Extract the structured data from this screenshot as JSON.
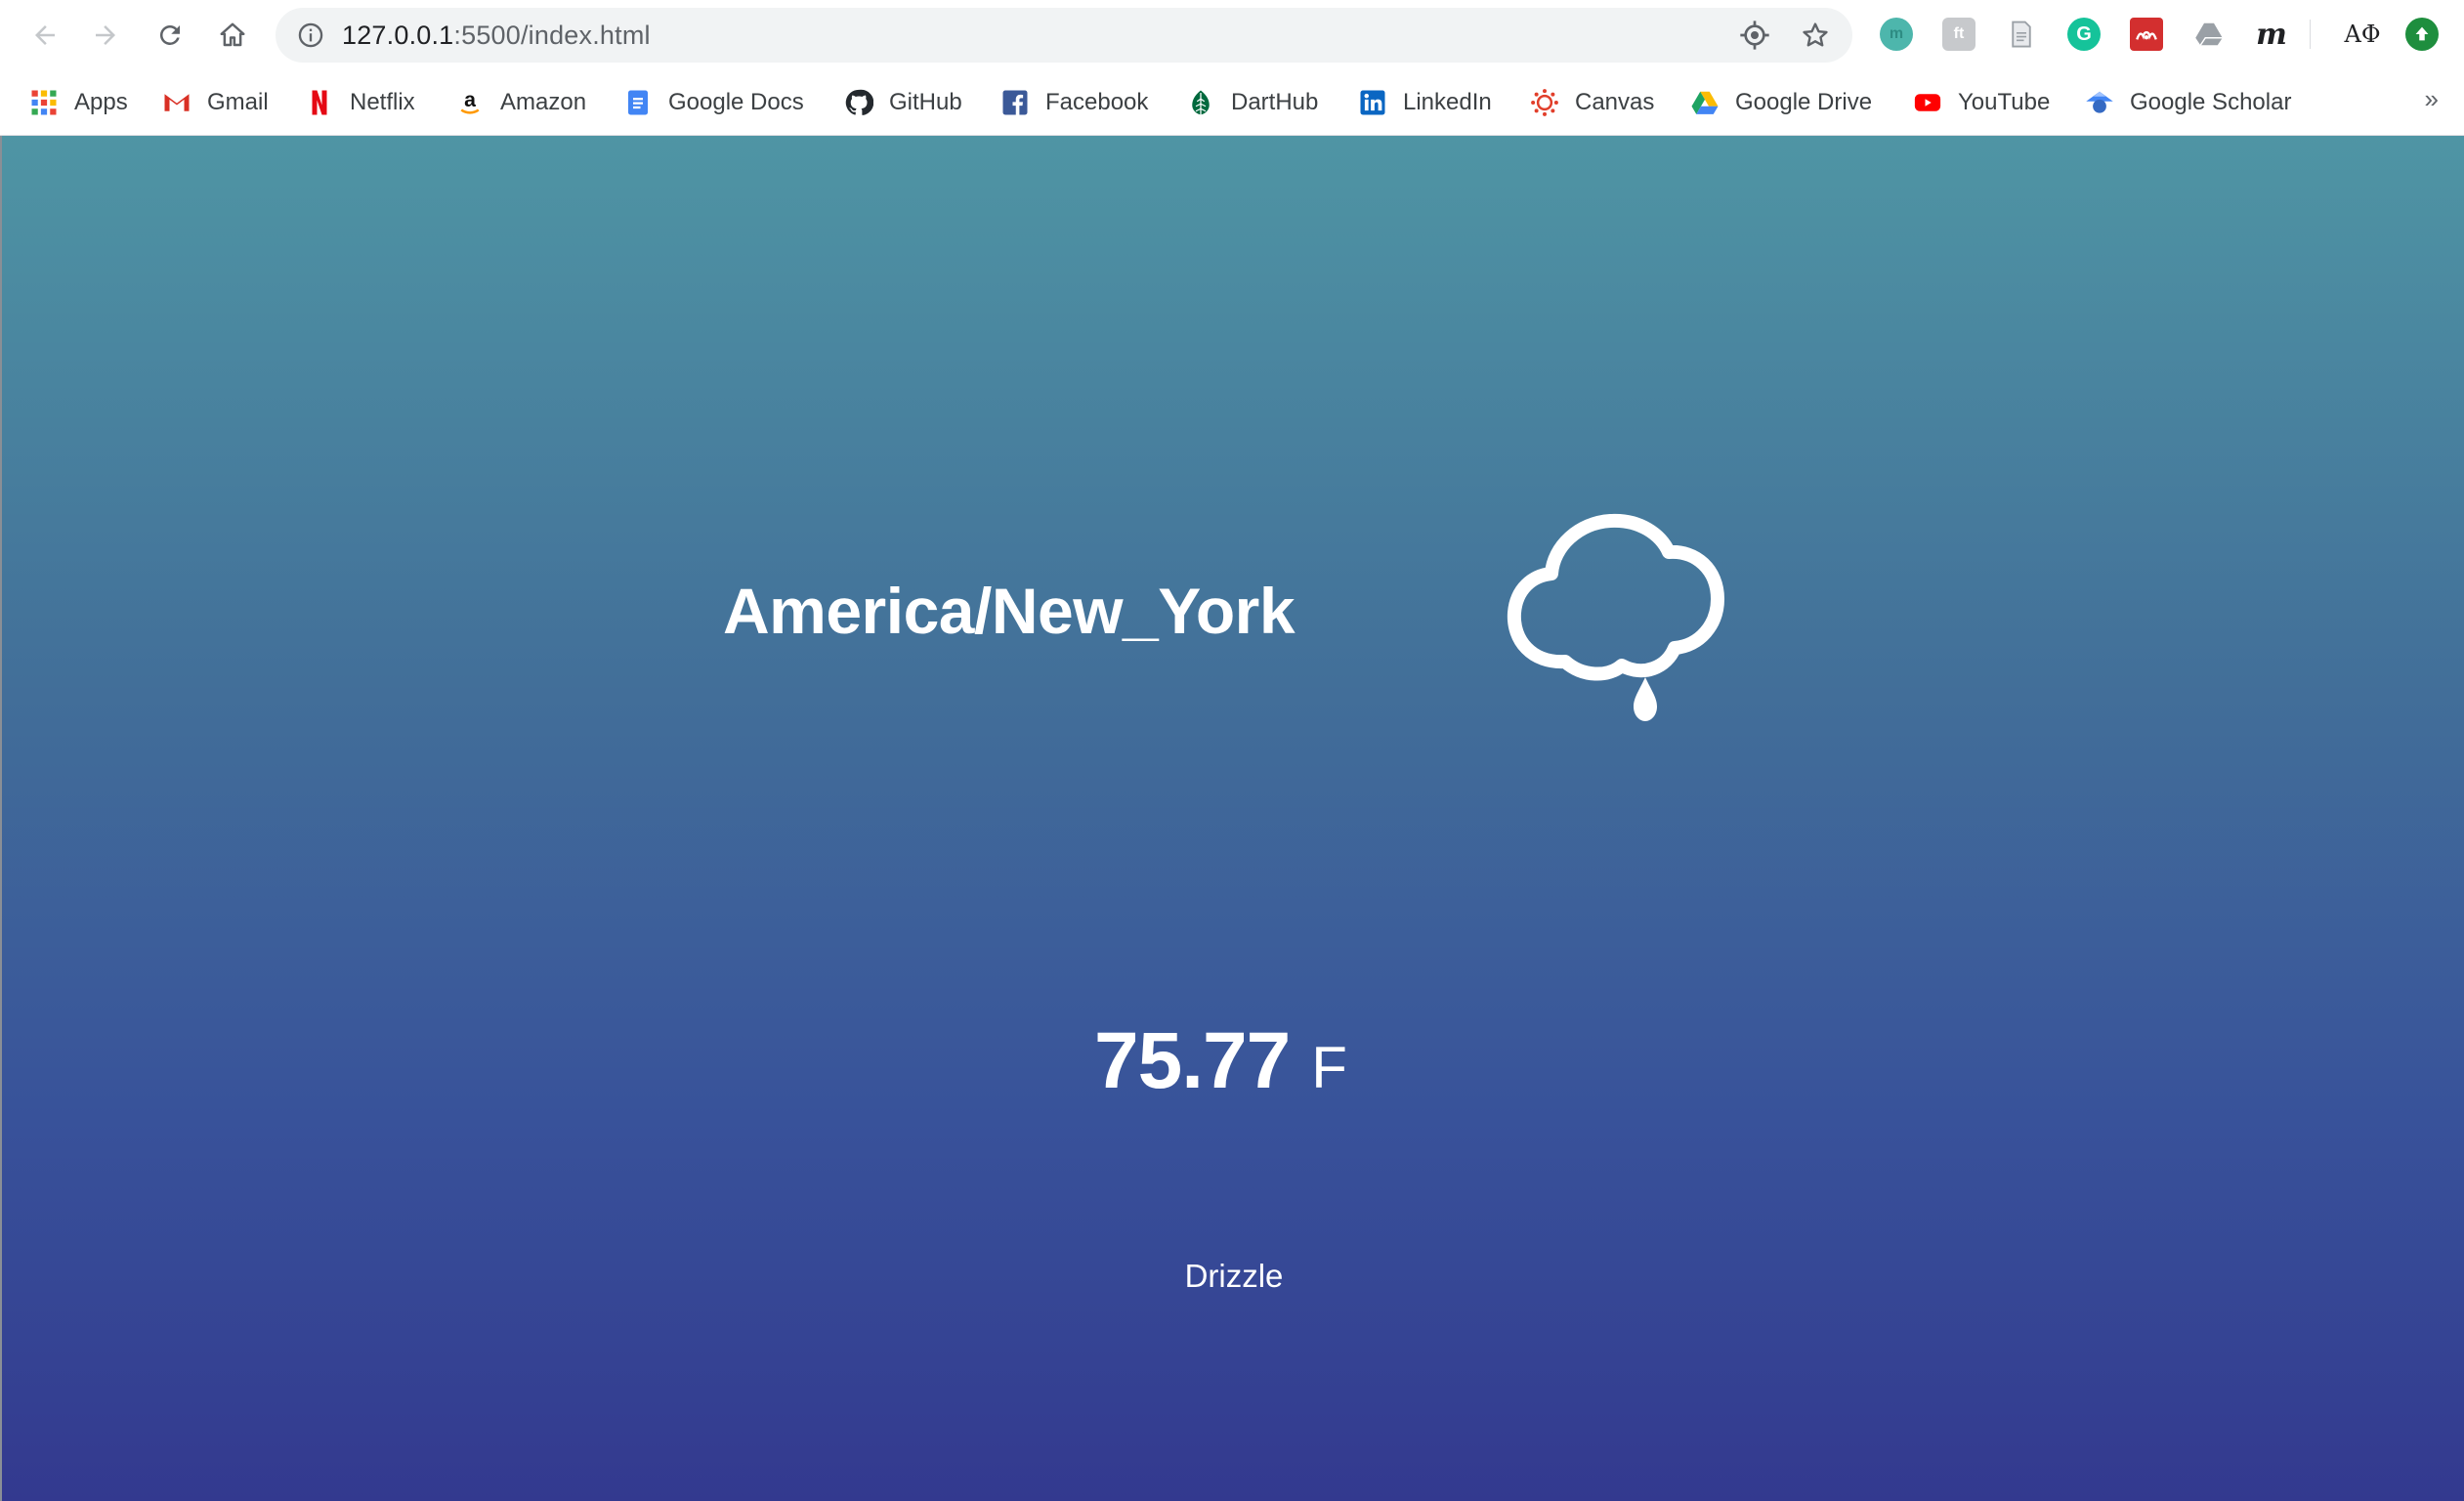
{
  "browser": {
    "url_host": "127.0.0.1",
    "url_rest": ":5500/index.html",
    "nav": {
      "back_icon": "arrow-left-icon",
      "forward_icon": "arrow-right-icon",
      "reload_icon": "reload-icon",
      "home_icon": "home-icon"
    },
    "extensions": [
      "m",
      "ft",
      "doc",
      "G",
      "mendeley",
      "drive",
      "m",
      "ΑΦ",
      "update"
    ]
  },
  "bookmarks": {
    "items": [
      {
        "label": "Apps",
        "icon": "apps-grid-icon"
      },
      {
        "label": "Gmail",
        "icon": "gmail-icon"
      },
      {
        "label": "Netflix",
        "icon": "netflix-icon"
      },
      {
        "label": "Amazon",
        "icon": "amazon-icon"
      },
      {
        "label": "Google Docs",
        "icon": "google-docs-icon"
      },
      {
        "label": "GitHub",
        "icon": "github-icon"
      },
      {
        "label": "Facebook",
        "icon": "facebook-icon"
      },
      {
        "label": "DartHub",
        "icon": "darthub-icon"
      },
      {
        "label": "LinkedIn",
        "icon": "linkedin-icon"
      },
      {
        "label": "Canvas",
        "icon": "canvas-icon"
      },
      {
        "label": "Google Drive",
        "icon": "google-drive-icon"
      },
      {
        "label": "YouTube",
        "icon": "youtube-icon"
      },
      {
        "label": "Google Scholar",
        "icon": "google-scholar-icon"
      }
    ],
    "more_label": "»"
  },
  "weather": {
    "timezone": "America/New_York",
    "icon": "cloud-drizzle-icon",
    "temperature": "75.77",
    "unit": "F",
    "description": "Drizzle"
  },
  "colors": {
    "gradient_top": "#4f95a4",
    "gradient_bottom": "#33398f",
    "text": "#ffffff"
  }
}
